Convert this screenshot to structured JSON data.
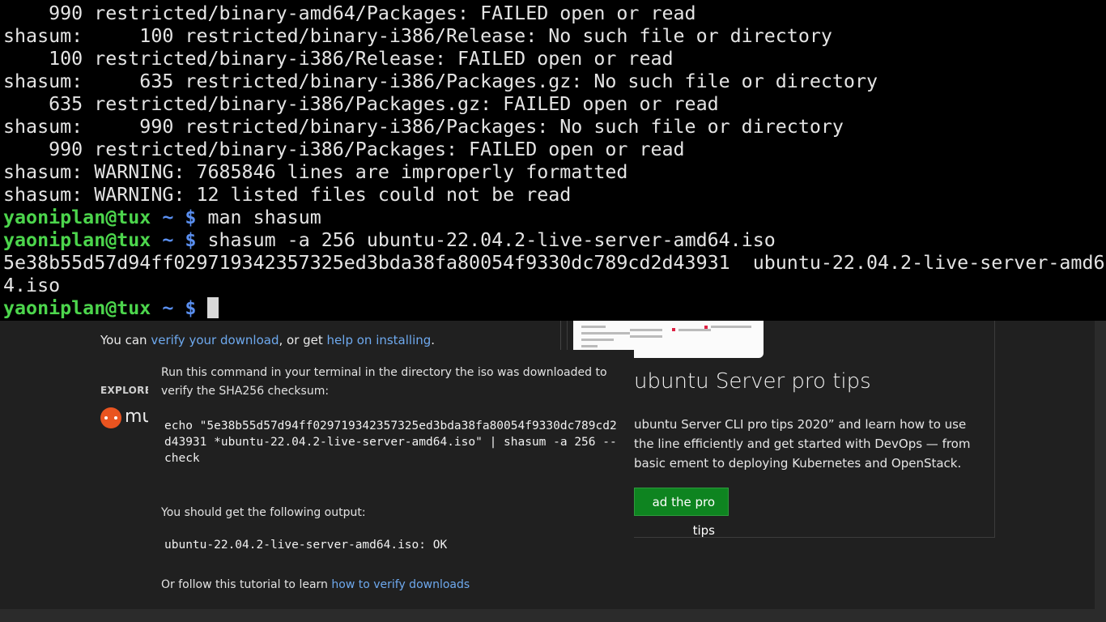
{
  "terminal": {
    "output_lines": [
      "    990 restricted/binary-amd64/Packages: FAILED open or read",
      "shasum:     100 restricted/binary-i386/Release: No such file or directory",
      "    100 restricted/binary-i386/Release: FAILED open or read",
      "shasum:     635 restricted/binary-i386/Packages.gz: No such file or directory",
      "    635 restricted/binary-i386/Packages.gz: FAILED open or read",
      "shasum:     990 restricted/binary-i386/Packages: No such file or directory",
      "    990 restricted/binary-i386/Packages: FAILED open or read",
      "shasum: WARNING: 7685846 lines are improperly formatted",
      "shasum: WARNING: 12 listed files could not be read"
    ],
    "prompt_user": "yaoniplan@tux",
    "prompt_path": "~ $",
    "command_1": "man shasum",
    "command_2": "shasum -a 256 ubuntu-22.04.2-live-server-amd64.iso",
    "checksum_line_1": "5e38b55d57d94ff029719342357325ed3bda38fa80054f9330dc789cd2d43931  ubuntu-22.04.2-live-server-amd6",
    "checksum_line_2": "4.iso",
    "colors": {
      "prompt_user": "#4cd54c",
      "prompt_path": "#5a8ff0",
      "text": "#e4e4e4",
      "background": "#000000"
    }
  },
  "webpage": {
    "verify_prefix": "You can ",
    "verify_link": "verify your download",
    "verify_middle": ", or get ",
    "help_link": "help on installing",
    "verify_suffix": ".",
    "explore_label": "EXPLORE:",
    "logo_partial_text": "mu",
    "card": {
      "title": "ubuntu Server pro tips",
      "description": "ubuntu Server CLI pro tips 2020” and learn how to use the line efficiently and get started with DevOps — from basic ement to deploying Kubernetes and OpenStack.",
      "button_label": "ad the pro tips"
    },
    "colors": {
      "link": "#6ea9ee",
      "button": "#0e8420",
      "logo": "#e95420",
      "background": "#202020"
    }
  },
  "verify_panel": {
    "intro": "Run this command in your terminal in the directory the iso was downloaded to verify the SHA256 checksum:",
    "command": "echo \"5e38b55d57d94ff029719342357325ed3bda38fa80054f9330dc789cd2d43931 *ubuntu-22.04.2-live-server-amd64.iso\" | shasum -a 256 --check",
    "output_label": "You should get the following output:",
    "expected_output": "ubuntu-22.04.2-live-server-amd64.iso: OK",
    "follow_prefix": "Or follow this tutorial to learn ",
    "follow_link": "how to verify downloads"
  }
}
